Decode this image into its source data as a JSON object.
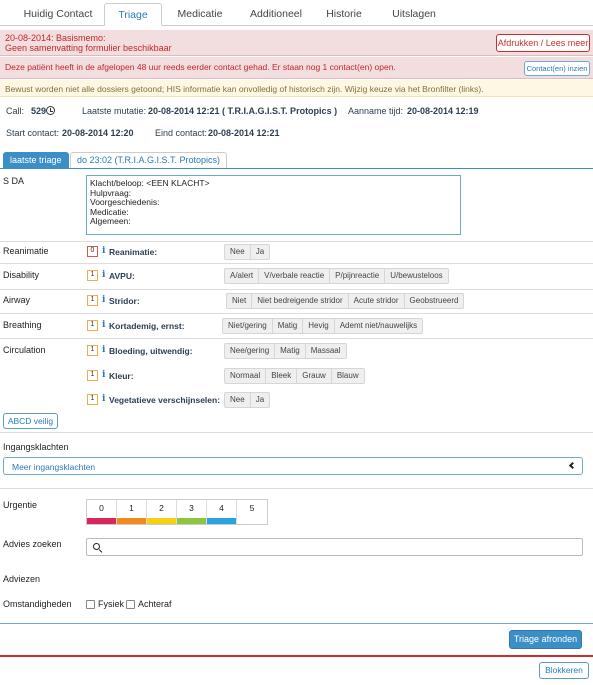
{
  "tabs": [
    "Huidig Contact",
    "Triage",
    "Medicatie",
    "Additioneel",
    "Historie",
    "Uitslagen"
  ],
  "alerts": {
    "memo_line1": "20-08-2014: Basismemo:",
    "memo_line2": "Geen samenvatting formulier beschikbaar",
    "print_button": "Afdrukken / Lees meer",
    "previous_contact": "Deze patiënt heeft in de afgelopen 48 uur reeds eerder contact gehad. Er staan nog 1 contact(en) open.",
    "contacts_button": "Contact(en) inzien",
    "warning": "Bewust worden niet alle dossiers getoond; HIS informatie kan onvolledig of historisch zijn. Wijzig keuze via het Bronfilter (links)."
  },
  "call_info": {
    "call_label": "Call:",
    "call_value": "529",
    "mutation_label": "Laatste mutatie:",
    "mutation_value": "20-08-2014 12:21 ( T.R.I.A.G.I.S.T. Protopics )",
    "accept_label": "Aanname tijd:",
    "accept_value": "20-08-2014 12:19",
    "start_label": "Start contact:",
    "start_value": "20-08-2014 12:20",
    "end_label": "Eind contact:",
    "end_value": "20-08-2014 12:21"
  },
  "triage_tabs": {
    "active": "laatste triage",
    "other": "do 23:02 (T.R.I.A.G.I.S.T. Protopics)"
  },
  "sda": {
    "label": "S DA",
    "text": "Klacht/beloop: <EEN KLACHT>\nHulpvraag:\nVoorgeschiedenis:\nMedicatie:\nAlgemeen:"
  },
  "abcd": {
    "reanimatie": {
      "section": "Reanimatie",
      "num": "0",
      "question": "Reanimatie:",
      "options": [
        "Nee",
        "Ja"
      ]
    },
    "disability": {
      "section": "Disability",
      "num": "1",
      "question": "AVPU:",
      "options": [
        "A/alert",
        "V/verbale reactie",
        "P/pijnreactie",
        "U/bewusteloos"
      ]
    },
    "airway": {
      "section": "Airway",
      "num": "1",
      "question": "Stridor:",
      "options": [
        "Niet",
        "Niet bedreigende stridor",
        "Acute stridor",
        "Geobstrueerd"
      ]
    },
    "breathing": {
      "section": "Breathing",
      "num": "1",
      "question": "Kortademig, ernst:",
      "options": [
        "Niet/gering",
        "Matig",
        "Hevig",
        "Ademt niet/nauwelijks"
      ]
    },
    "circulation": {
      "section": "Circulation",
      "num": "1",
      "question": "Bloeding, uitwendig:",
      "options": [
        "Nee/gering",
        "Matig",
        "Massaal"
      ]
    },
    "kleur": {
      "num": "1",
      "question": "Kleur:",
      "options": [
        "Normaal",
        "Bleek",
        "Grauw",
        "Blauw"
      ]
    },
    "vegetatief": {
      "num": "1",
      "question": "Vegetatieve verschijnselen:",
      "options": [
        "Nee",
        "Ja"
      ]
    }
  },
  "abcd_button": "ABCD veilig",
  "ingangsklachten": {
    "title": "Ingangsklachten",
    "more": "Meer ingangsklachten"
  },
  "urgentie": {
    "label": "Urgentie",
    "levels": [
      "0",
      "1",
      "2",
      "3",
      "4",
      "5"
    ],
    "colors": [
      "#d9265c",
      "#f28a1f",
      "#f6d10f",
      "#8cc63e",
      "#29a3dd",
      "#ffffff"
    ]
  },
  "advies": {
    "label": "Advies zoeken"
  },
  "adviezen": {
    "label": "Adviezen"
  },
  "omstandigheden": {
    "label": "Omstandigheden",
    "options": [
      "Fysiek",
      "Achteraf"
    ]
  },
  "buttons": {
    "finish": "Triage afronden",
    "block": "Blokkeren"
  }
}
